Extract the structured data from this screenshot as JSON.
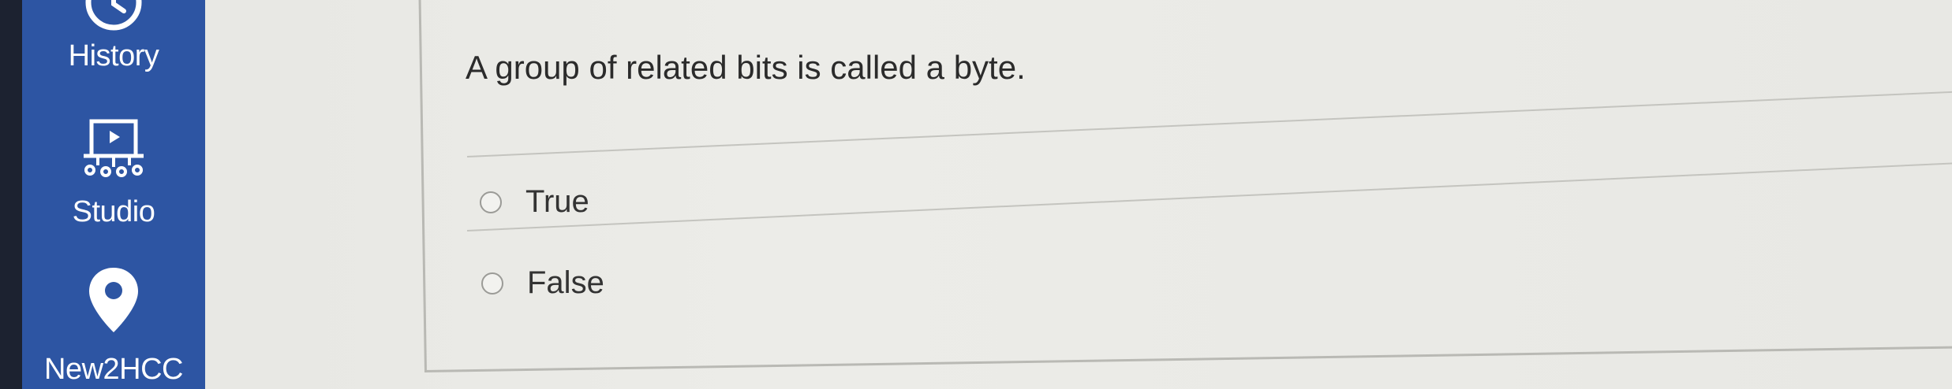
{
  "sidebar": {
    "items": [
      {
        "label": "History",
        "icon": "clock-icon"
      },
      {
        "label": "Studio",
        "icon": "studio-icon"
      },
      {
        "label": "New2HCC",
        "icon": "map-pin-icon"
      }
    ],
    "background": "#2d55a3"
  },
  "question": {
    "text": "A group of related bits is called a byte.",
    "answers": [
      {
        "label": "True"
      },
      {
        "label": "False"
      }
    ]
  }
}
